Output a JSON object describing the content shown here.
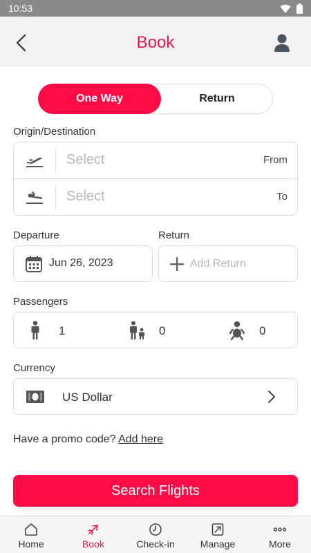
{
  "status_bar": {
    "time": "10:53"
  },
  "header": {
    "title": "Book",
    "back_icon": "chevron-left-icon",
    "user_icon": "user-icon"
  },
  "trip_type": {
    "options": [
      "One Way",
      "Return"
    ],
    "selected": "One Way"
  },
  "origin_destination": {
    "label": "Origin/Destination",
    "from": {
      "placeholder": "Select",
      "tag": "From",
      "icon": "plane-takeoff-icon"
    },
    "to": {
      "placeholder": "Select",
      "tag": "To",
      "icon": "plane-landing-icon"
    }
  },
  "departure": {
    "label": "Departure",
    "value": "Jun 26, 2023",
    "icon": "calendar-icon"
  },
  "return_date": {
    "label": "Return",
    "placeholder": "Add Return",
    "icon": "plus-icon"
  },
  "passengers": {
    "label": "Passengers",
    "adults": {
      "count": "1",
      "icon": "adult-icon"
    },
    "children": {
      "count": "0",
      "icon": "child-icon"
    },
    "infants": {
      "count": "0",
      "icon": "infant-icon"
    }
  },
  "currency": {
    "label": "Currency",
    "value": "US Dollar",
    "icon": "money-icon"
  },
  "promo": {
    "text": "Have a promo code?",
    "link": "Add here"
  },
  "search_button": {
    "label": "Search Flights"
  },
  "tab_bar": {
    "items": [
      {
        "label": "Home",
        "icon": "home-icon"
      },
      {
        "label": "Book",
        "icon": "plane-icon",
        "active": true
      },
      {
        "label": "Check-in",
        "icon": "clock-icon"
      },
      {
        "label": "Manage",
        "icon": "manage-icon"
      },
      {
        "label": "More",
        "icon": "more-icon"
      }
    ]
  },
  "colors": {
    "accent": "#ff0b45",
    "title": "#e8174a",
    "header_bg": "#f2f2f2",
    "status_bar": "#8a8a8a"
  }
}
